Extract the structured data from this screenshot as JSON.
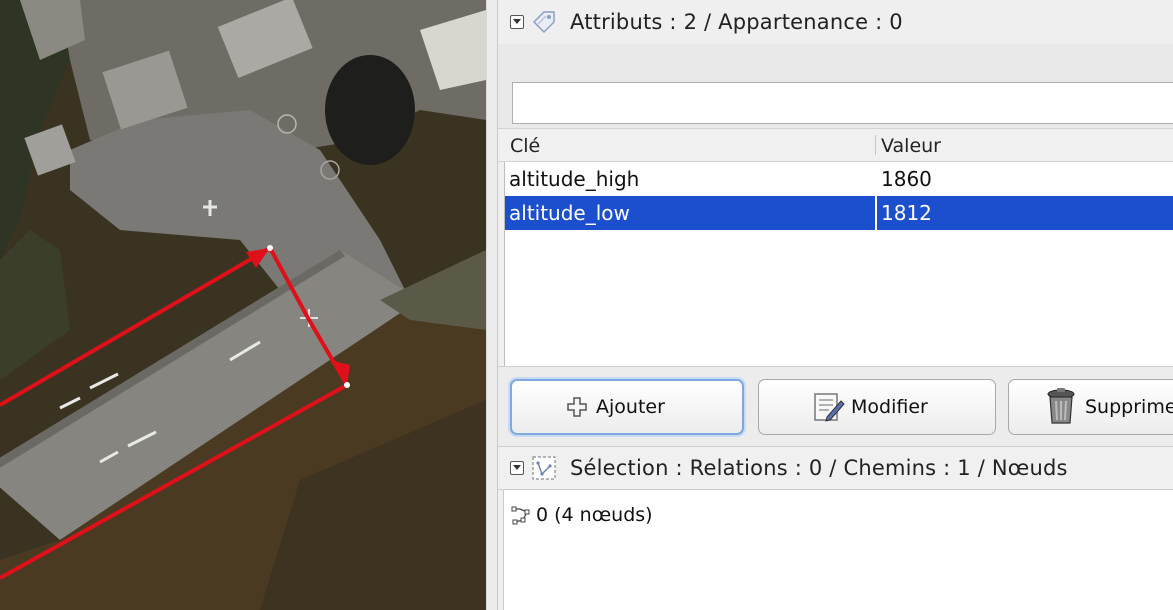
{
  "tags_panel": {
    "title": "Attributs : 2 / Appartenance : 0",
    "filter_value": "",
    "columns": {
      "key": "Clé",
      "value": "Valeur"
    },
    "rows": [
      {
        "key": "altitude_high",
        "value": "1860"
      },
      {
        "key": "altitude_low",
        "value": "1812",
        "selected": true
      }
    ],
    "buttons": {
      "add": "Ajouter",
      "edit": "Modifier",
      "delete": "Supprimer"
    }
  },
  "selection_panel": {
    "title": "Sélection : Relations : 0 / Chemins : 1 / Nœuds",
    "items": [
      {
        "label": "0 (4 nœuds)",
        "icon": "way-icon"
      }
    ]
  },
  "colors": {
    "selection": "#1c4fce",
    "way_stroke": "#e0101a",
    "focus_ring": "#7ea8e0"
  },
  "icons": [
    "collapse-icon",
    "tag-icon",
    "plus-icon",
    "edit-icon",
    "trash-icon",
    "selection-icon",
    "way-icon"
  ]
}
